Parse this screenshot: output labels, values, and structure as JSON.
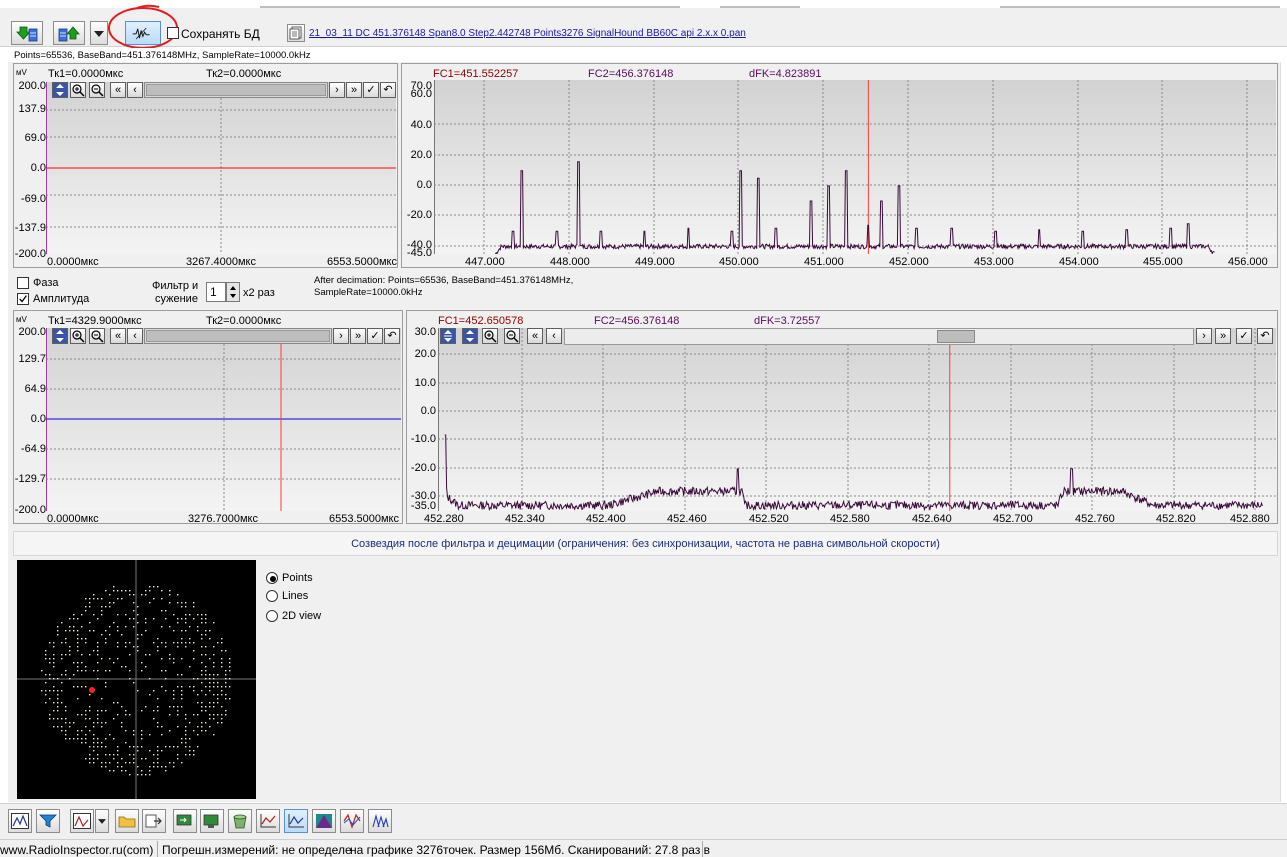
{
  "toolbar": {
    "save_db_label": "Сохранять БД",
    "file_name": "21_03_11 DC 451.376148 Span8.0 Step2.442748 Points3276 SignalHound BB60C api 2.x.x 0.pan"
  },
  "info_line": "Points=65536, BaseBand=451.376148MHz,  SampleRate=10000.0kHz",
  "time1": {
    "unit": "мV",
    "tk1": "Тк1=0.0000мкс",
    "tk2": "Тк2=0.0000мкс",
    "y_ticks": [
      "200.0",
      "137.9",
      "69.0",
      "0.0",
      "-69.0",
      "-137.9",
      "-200.0"
    ],
    "x_ticks": [
      "0.0000мкс",
      "3267.4000мкс",
      "6553.5000мкс"
    ]
  },
  "spec1": {
    "fc1": "FC1=451.552257",
    "fc2": "FC2=456.376148",
    "dfk": "dFK=4.823891",
    "y_ticks": [
      "70.0",
      "60.0",
      "40.0",
      "20.0",
      "0.0",
      "-20.0",
      "-40.0",
      "-45.0"
    ],
    "x_ticks": [
      "447.000",
      "448.000",
      "449.000",
      "450.000",
      "451.000",
      "452.000",
      "453.000",
      "454.000",
      "455.000",
      "456.000"
    ]
  },
  "controls": {
    "phase_label": "Фаза",
    "amplitude_label": "Амплитуда",
    "filter_label_1": "Фильтр и",
    "filter_label_2": "сужение",
    "filter_value": "1",
    "filter_suffix": "x2 раз",
    "decimation_1": "After decimation: Points=65536, BaseBand=451.376148MHz,",
    "decimation_2": "SampleRate=10000.0kHz"
  },
  "time2": {
    "unit": "мV",
    "tk1": "Тк1=4329.9000мкс",
    "tk2": "Тк2=0.0000мкс",
    "y_ticks": [
      "200.0",
      "129.7",
      "64.9",
      "0.0",
      "-64.9",
      "-129.7",
      "-200.0"
    ],
    "x_ticks": [
      "0.0000мкс",
      "3276.7000мкс",
      "6553.5000мкс"
    ]
  },
  "spec2": {
    "fc1": "FC1=452.650578",
    "fc2": "FC2=456.376148",
    "dfk": "dFK=3.72557",
    "y_ticks": [
      "30.0",
      "20.0",
      "10.0",
      "0.0",
      "-10.0",
      "-20.0",
      "-30.0",
      "-35.0"
    ],
    "x_ticks": [
      "452.280",
      "452.340",
      "452.400",
      "452.460",
      "452.520",
      "452.580",
      "452.640",
      "452.700",
      "452.760",
      "452.820",
      "452.880"
    ]
  },
  "constellation_title": "Созвездия после фильтра и децимации (ограничения: без синхронизации, частота не равна символьной скорости)",
  "view_options": {
    "points": "Points",
    "lines": "Lines",
    "view2d": "2D view",
    "selected": "Points"
  },
  "status_bar": {
    "site": "www.RadioInspector.ru(com)",
    "error": "Погрешн.измерений: не определе",
    "info": "на графике 3276точек.  Размер 156Мб. Сканирований: 27.8 раз в"
  },
  "colors": {
    "marker": "#ff3b3b",
    "trace": "#3a0a3a",
    "time_trace_1": "#ff0000",
    "time_trace_2": "#0000cc",
    "header_text": "#5a0a5a",
    "fc1_text": "#8b0000",
    "annotation": "#e02020"
  },
  "chart_data": [
    {
      "type": "line",
      "x": [
        447.3,
        447.5,
        447.6,
        448.0,
        448.25,
        448.5,
        449.0,
        449.5,
        450.0,
        450.1,
        450.3,
        450.5,
        450.9,
        451.1,
        451.3,
        451.55,
        451.7,
        451.9,
        452.1,
        452.5,
        453.0,
        453.5,
        454.0,
        454.5,
        455.0,
        455.2,
        455.5
      ],
      "values": [
        -45,
        -30,
        10,
        -30,
        16,
        -30,
        -30,
        -28,
        -30,
        10,
        5,
        -28,
        -10,
        0,
        10,
        -26,
        -10,
        0,
        -28,
        -28,
        -30,
        -29,
        -30,
        -29,
        -28,
        -25,
        -45
      ],
      "xlabel": "",
      "ylabel": "",
      "xlim": [
        446.6,
        456.2
      ],
      "ylim": [
        -45,
        70
      ]
    },
    {
      "type": "line",
      "x": [
        452.28,
        452.282,
        452.29,
        452.4,
        452.495,
        452.5,
        452.6,
        452.64,
        452.73,
        452.74,
        452.8,
        452.88
      ],
      "values": [
        -8,
        -30,
        -33,
        -33,
        -20,
        -33,
        -33,
        -33,
        -33,
        -20,
        -33,
        -33
      ],
      "xlabel": "",
      "ylabel": "",
      "xlim": [
        452.275,
        452.89
      ],
      "ylim": [
        -35,
        30
      ]
    }
  ]
}
